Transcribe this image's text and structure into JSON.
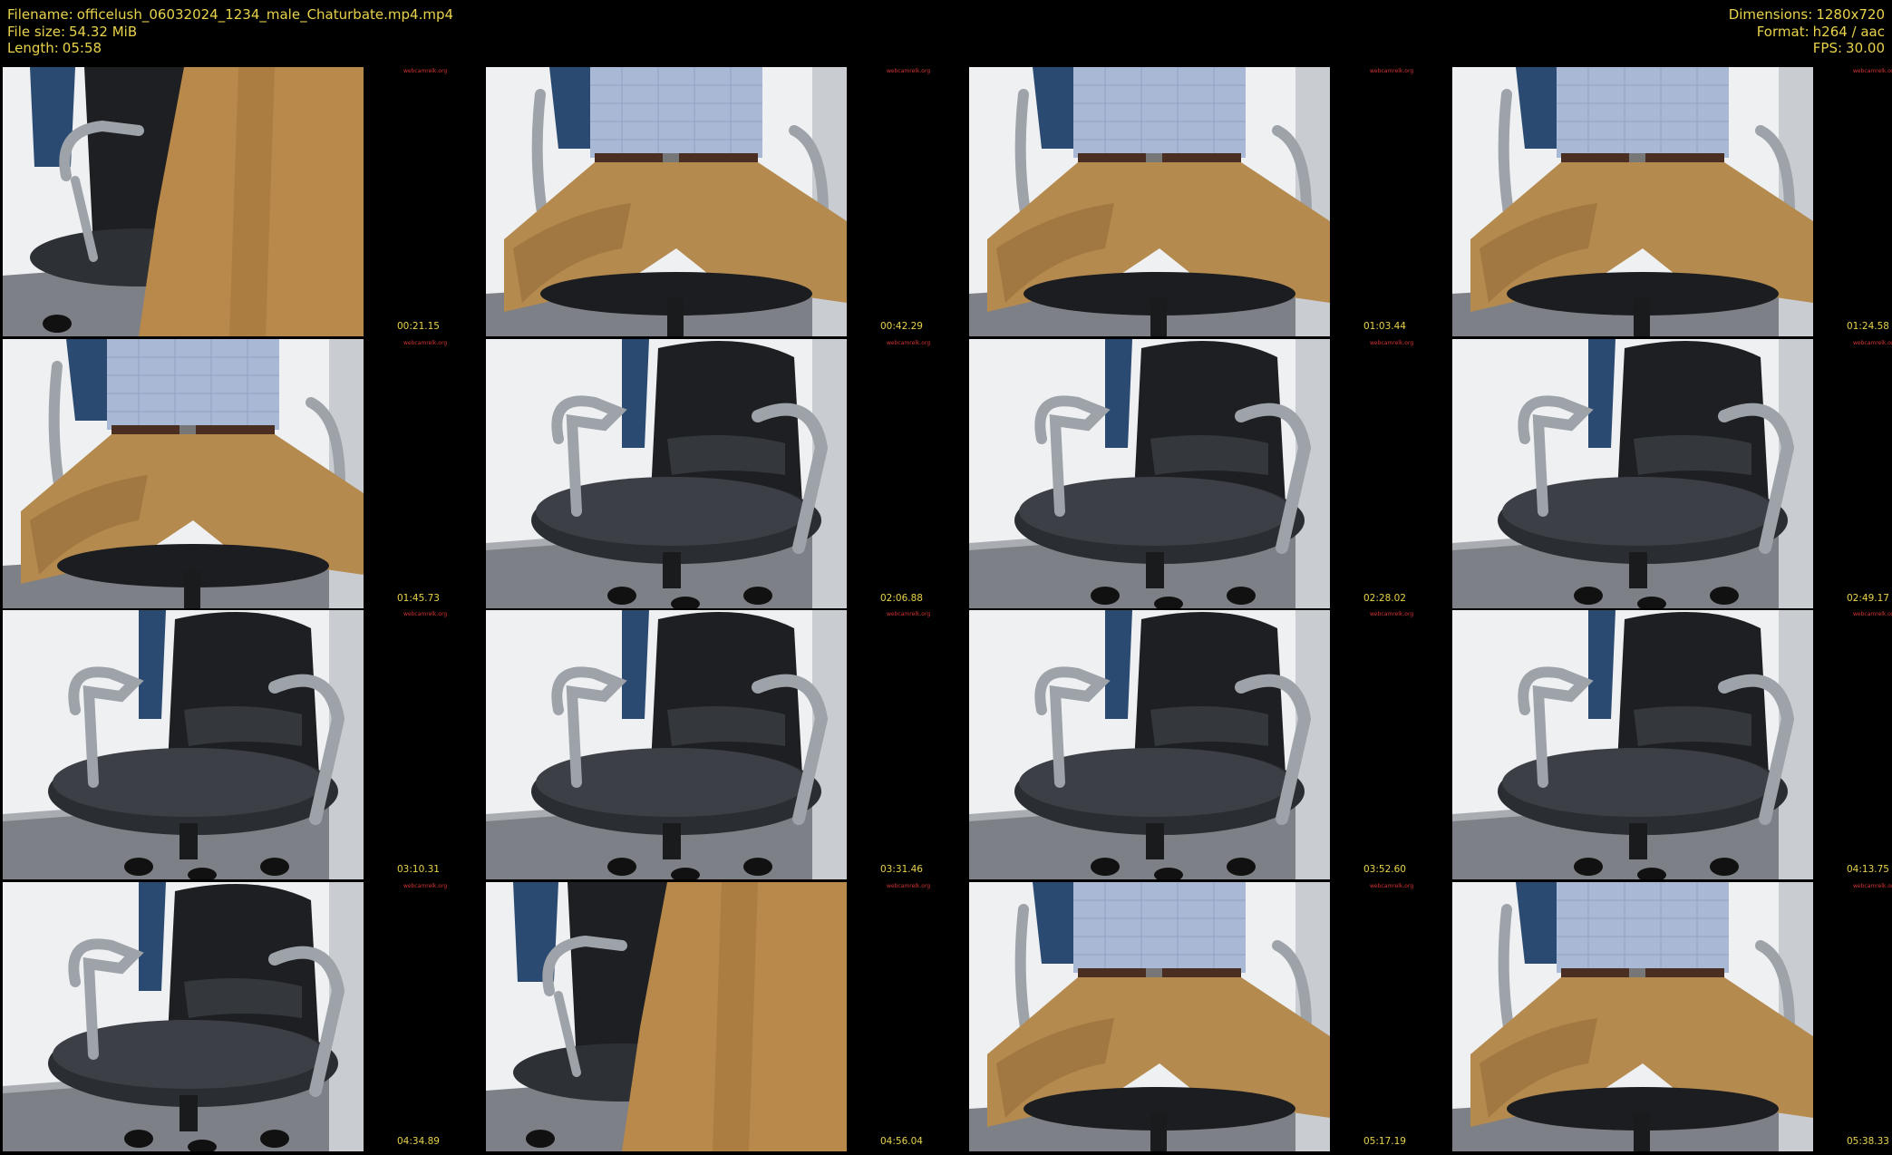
{
  "header": {
    "left": {
      "filename_label": "Filename:",
      "filename": "officelush_06032024_1234_male_Chaturbate.mp4.mp4",
      "filesize_label": "File size:",
      "filesize": "54.32 MiB",
      "length_label": "Length:",
      "length": "05:58"
    },
    "right": {
      "dimensions_label": "Dimensions:",
      "dimensions": "1280x720",
      "format_label": "Format:",
      "format": "h264 / aac",
      "fps_label": "FPS:",
      "fps": "30.00"
    }
  },
  "watermark": "webcamrelk.org",
  "colors": {
    "text": "#e8d24a",
    "watermark": "#d43434",
    "background": "#000000"
  },
  "thumbnails": [
    {
      "timestamp": "00:21.15",
      "scene": "chair-standing"
    },
    {
      "timestamp": "00:42.29",
      "scene": "seated"
    },
    {
      "timestamp": "01:03.44",
      "scene": "seated"
    },
    {
      "timestamp": "01:24.58",
      "scene": "seated"
    },
    {
      "timestamp": "01:45.73",
      "scene": "seated"
    },
    {
      "timestamp": "02:06.88",
      "scene": "empty-chair"
    },
    {
      "timestamp": "02:28.02",
      "scene": "empty-chair"
    },
    {
      "timestamp": "02:49.17",
      "scene": "empty-chair"
    },
    {
      "timestamp": "03:10.31",
      "scene": "empty-chair"
    },
    {
      "timestamp": "03:31.46",
      "scene": "empty-chair"
    },
    {
      "timestamp": "03:52.60",
      "scene": "empty-chair"
    },
    {
      "timestamp": "04:13.75",
      "scene": "empty-chair"
    },
    {
      "timestamp": "04:34.89",
      "scene": "empty-chair"
    },
    {
      "timestamp": "04:56.04",
      "scene": "chair-standing"
    },
    {
      "timestamp": "05:17.19",
      "scene": "seated"
    },
    {
      "timestamp": "05:38.33",
      "scene": "seated"
    }
  ]
}
